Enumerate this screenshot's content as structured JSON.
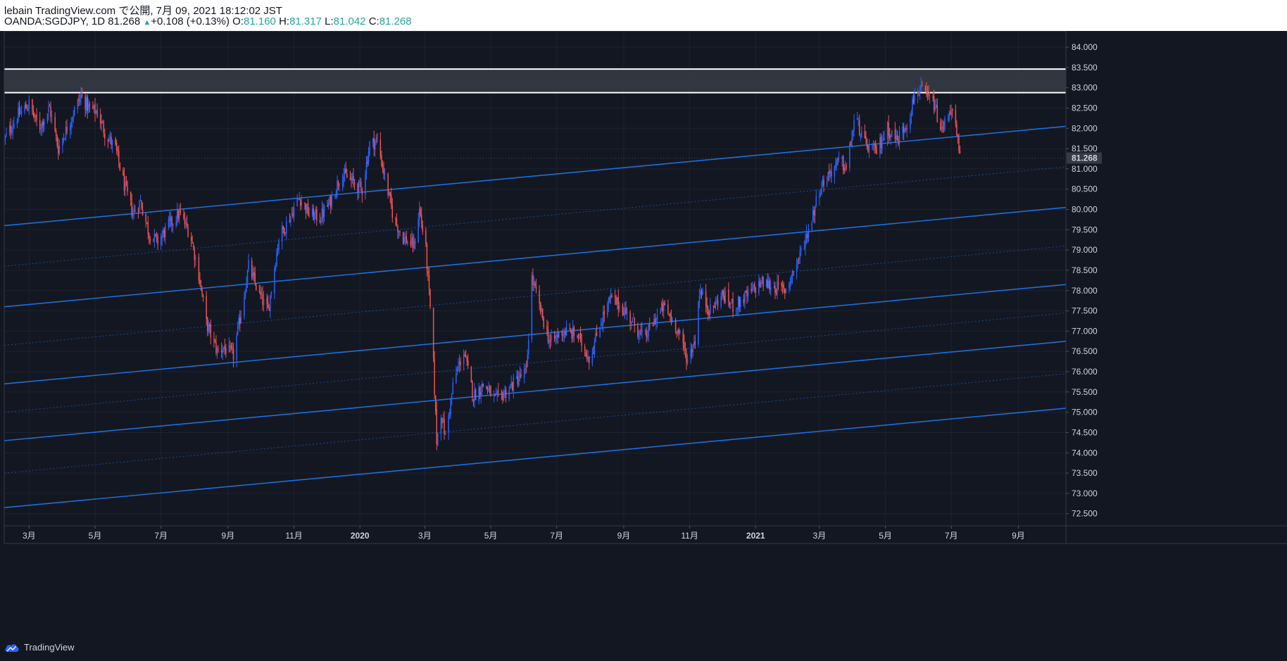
{
  "header": {
    "author": "lebain",
    "publish_line": "TradingView.com で公開, 7月 09, 2021 18:12:02 JST",
    "symbol": "OANDA:SGDJPY, 1D",
    "last_price": "81.268",
    "change": "+0.108 (+0.13%)",
    "open_label": "O:",
    "open_value": "81.160",
    "high_label": "H:",
    "high_value": "81.317",
    "low_label": "L:",
    "low_value": "81.042",
    "close_label": "C:",
    "close_value": "81.268"
  },
  "footer": {
    "brand": "TradingView",
    "logo_icon": "tradingview-cloud-icon"
  },
  "colors": {
    "background": "#131722",
    "up_candle": "#2962ff",
    "down_candle": "#ef5350",
    "channel_line": "#1e6fd9",
    "resistance_line": "#ffffff",
    "zone_fill": "#363a45",
    "grid": "#1e2230",
    "text": "#d1d4dc",
    "ohlc_green": "#26a69a"
  },
  "chart_data": {
    "type": "candlestick",
    "instrument": "OANDA:SGDJPY",
    "timeframe": "1D",
    "y_axis_labels": [
      "84.000",
      "83.500",
      "83.000",
      "82.500",
      "82.000",
      "81.500",
      "81.000",
      "80.500",
      "80.000",
      "79.500",
      "79.000",
      "78.500",
      "78.000",
      "77.500",
      "77.000",
      "76.500",
      "76.000",
      "75.500",
      "75.000",
      "74.500",
      "74.000",
      "73.500",
      "73.000",
      "72.500"
    ],
    "ylim": [
      72.2,
      84.4
    ],
    "x_axis_labels": [
      {
        "label": "3月",
        "date": "2019-03-01",
        "bold": false
      },
      {
        "label": "5月",
        "date": "2019-05-01",
        "bold": false
      },
      {
        "label": "7月",
        "date": "2019-07-01",
        "bold": false
      },
      {
        "label": "9月",
        "date": "2019-09-01",
        "bold": false
      },
      {
        "label": "11月",
        "date": "2019-11-01",
        "bold": false
      },
      {
        "label": "2020",
        "date": "2020-01-01",
        "bold": true
      },
      {
        "label": "3月",
        "date": "2020-03-01",
        "bold": false
      },
      {
        "label": "5月",
        "date": "2020-05-01",
        "bold": false
      },
      {
        "label": "7月",
        "date": "2020-07-01",
        "bold": false
      },
      {
        "label": "9月",
        "date": "2020-09-01",
        "bold": false
      },
      {
        "label": "11月",
        "date": "2020-11-01",
        "bold": false
      },
      {
        "label": "2021",
        "date": "2021-01-01",
        "bold": true
      },
      {
        "label": "3月",
        "date": "2021-03-01",
        "bold": false
      },
      {
        "label": "5月",
        "date": "2021-05-01",
        "bold": false
      },
      {
        "label": "7月",
        "date": "2021-07-01",
        "bold": false
      },
      {
        "label": "9月",
        "date": "2021-09-01",
        "bold": false
      }
    ],
    "x_range": [
      "2019-02-06",
      "2021-10-15"
    ],
    "current_price_label": "81.268",
    "price_path": [
      [
        "2019-02-06",
        81.7
      ],
      [
        "2019-02-18",
        82.3
      ],
      [
        "2019-03-01",
        82.6
      ],
      [
        "2019-03-10",
        82.0
      ],
      [
        "2019-03-20",
        82.5
      ],
      [
        "2019-03-28",
        81.5
      ],
      [
        "2019-04-08",
        82.2
      ],
      [
        "2019-04-18",
        82.8
      ],
      [
        "2019-04-25",
        82.5
      ],
      [
        "2019-05-03",
        82.4
      ],
      [
        "2019-05-10",
        81.9
      ],
      [
        "2019-05-20",
        81.5
      ],
      [
        "2019-05-28",
        80.6
      ],
      [
        "2019-06-05",
        79.9
      ],
      [
        "2019-06-12",
        80.2
      ],
      [
        "2019-06-20",
        79.4
      ],
      [
        "2019-06-28",
        79.2
      ],
      [
        "2019-07-08",
        79.6
      ],
      [
        "2019-07-18",
        79.9
      ],
      [
        "2019-07-28",
        79.4
      ],
      [
        "2019-08-05",
        78.4
      ],
      [
        "2019-08-12",
        77.2
      ],
      [
        "2019-08-22",
        76.5
      ],
      [
        "2019-08-28",
        76.6
      ],
      [
        "2019-09-06",
        76.4
      ],
      [
        "2019-09-14",
        77.6
      ],
      [
        "2019-09-20",
        78.6
      ],
      [
        "2019-09-30",
        77.9
      ],
      [
        "2019-10-08",
        77.5
      ],
      [
        "2019-10-18",
        79.3
      ],
      [
        "2019-10-28",
        79.8
      ],
      [
        "2019-11-06",
        80.3
      ],
      [
        "2019-11-15",
        79.9
      ],
      [
        "2019-11-25",
        79.8
      ],
      [
        "2019-12-05",
        80.2
      ],
      [
        "2019-12-15",
        80.9
      ],
      [
        "2019-12-24",
        80.7
      ],
      [
        "2020-01-03",
        80.5
      ],
      [
        "2020-01-10",
        81.6
      ],
      [
        "2020-01-17",
        81.7
      ],
      [
        "2020-01-24",
        80.8
      ],
      [
        "2020-02-01",
        79.8
      ],
      [
        "2020-02-10",
        79.3
      ],
      [
        "2020-02-20",
        79.1
      ],
      [
        "2020-02-25",
        80.0
      ],
      [
        "2020-03-02",
        79.0
      ],
      [
        "2020-03-08",
        76.8
      ],
      [
        "2020-03-12",
        74.3
      ],
      [
        "2020-03-16",
        75.0
      ],
      [
        "2020-03-20",
        74.4
      ],
      [
        "2020-03-28",
        75.8
      ],
      [
        "2020-04-06",
        76.5
      ],
      [
        "2020-04-15",
        75.4
      ],
      [
        "2020-04-25",
        75.7
      ],
      [
        "2020-05-05",
        75.3
      ],
      [
        "2020-05-15",
        75.5
      ],
      [
        "2020-05-25",
        75.8
      ],
      [
        "2020-06-03",
        76.0
      ],
      [
        "2020-06-08",
        78.3
      ],
      [
        "2020-06-15",
        77.6
      ],
      [
        "2020-06-25",
        76.7
      ],
      [
        "2020-07-06",
        77.0
      ],
      [
        "2020-07-20",
        76.9
      ],
      [
        "2020-08-01",
        76.3
      ],
      [
        "2020-08-10",
        77.2
      ],
      [
        "2020-08-20",
        77.8
      ],
      [
        "2020-08-30",
        77.6
      ],
      [
        "2020-09-10",
        77.2
      ],
      [
        "2020-09-20",
        76.8
      ],
      [
        "2020-09-30",
        77.3
      ],
      [
        "2020-10-08",
        77.6
      ],
      [
        "2020-10-20",
        77.1
      ],
      [
        "2020-10-30",
        76.3
      ],
      [
        "2020-11-06",
        76.8
      ],
      [
        "2020-11-10",
        78.0
      ],
      [
        "2020-11-20",
        77.5
      ],
      [
        "2020-12-01",
        77.9
      ],
      [
        "2020-12-12",
        77.6
      ],
      [
        "2020-12-25",
        77.9
      ],
      [
        "2021-01-06",
        78.2
      ],
      [
        "2021-01-18",
        78.1
      ],
      [
        "2021-01-28",
        78.0
      ],
      [
        "2021-02-10",
        78.8
      ],
      [
        "2021-02-20",
        79.6
      ],
      [
        "2021-03-01",
        80.5
      ],
      [
        "2021-03-10",
        80.9
      ],
      [
        "2021-03-20",
        81.2
      ],
      [
        "2021-03-26",
        81.0
      ],
      [
        "2021-04-03",
        82.3
      ],
      [
        "2021-04-12",
        81.6
      ],
      [
        "2021-04-22",
        81.4
      ],
      [
        "2021-05-03",
        82.0
      ],
      [
        "2021-05-12",
        81.7
      ],
      [
        "2021-05-22",
        82.2
      ],
      [
        "2021-05-30",
        83.0
      ],
      [
        "2021-06-07",
        82.8
      ],
      [
        "2021-06-15",
        82.6
      ],
      [
        "2021-06-22",
        81.9
      ],
      [
        "2021-06-30",
        82.5
      ],
      [
        "2021-07-05",
        82.0
      ],
      [
        "2021-07-09",
        81.27
      ]
    ],
    "horizontal_lines": [
      {
        "name": "resistance-upper",
        "price": 83.46
      },
      {
        "name": "resistance-lower",
        "price": 82.88
      }
    ],
    "zone": {
      "top": 83.46,
      "bottom": 82.88
    },
    "channel_lines": [
      {
        "start": [
          "2019-02-06",
          79.6
        ],
        "end": [
          "2021-10-15",
          82.05
        ],
        "style": "solid"
      },
      {
        "start": [
          "2019-02-06",
          77.6
        ],
        "end": [
          "2021-10-15",
          80.05
        ],
        "style": "solid"
      },
      {
        "start": [
          "2019-02-06",
          75.7
        ],
        "end": [
          "2021-10-15",
          78.15
        ],
        "style": "solid"
      },
      {
        "start": [
          "2019-02-06",
          74.3
        ],
        "end": [
          "2021-10-15",
          76.75
        ],
        "style": "solid"
      },
      {
        "start": [
          "2019-02-06",
          72.65
        ],
        "end": [
          "2021-10-15",
          75.1
        ],
        "style": "solid"
      },
      {
        "start": [
          "2019-02-06",
          78.6
        ],
        "end": [
          "2021-10-15",
          81.05
        ],
        "style": "dotted"
      },
      {
        "start": [
          "2019-02-06",
          76.65
        ],
        "end": [
          "2021-10-15",
          79.1
        ],
        "style": "dotted"
      },
      {
        "start": [
          "2019-02-06",
          75.0
        ],
        "end": [
          "2021-10-15",
          77.45
        ],
        "style": "dotted"
      },
      {
        "start": [
          "2019-02-06",
          73.5
        ],
        "end": [
          "2021-10-15",
          75.95
        ],
        "style": "dotted"
      }
    ]
  }
}
